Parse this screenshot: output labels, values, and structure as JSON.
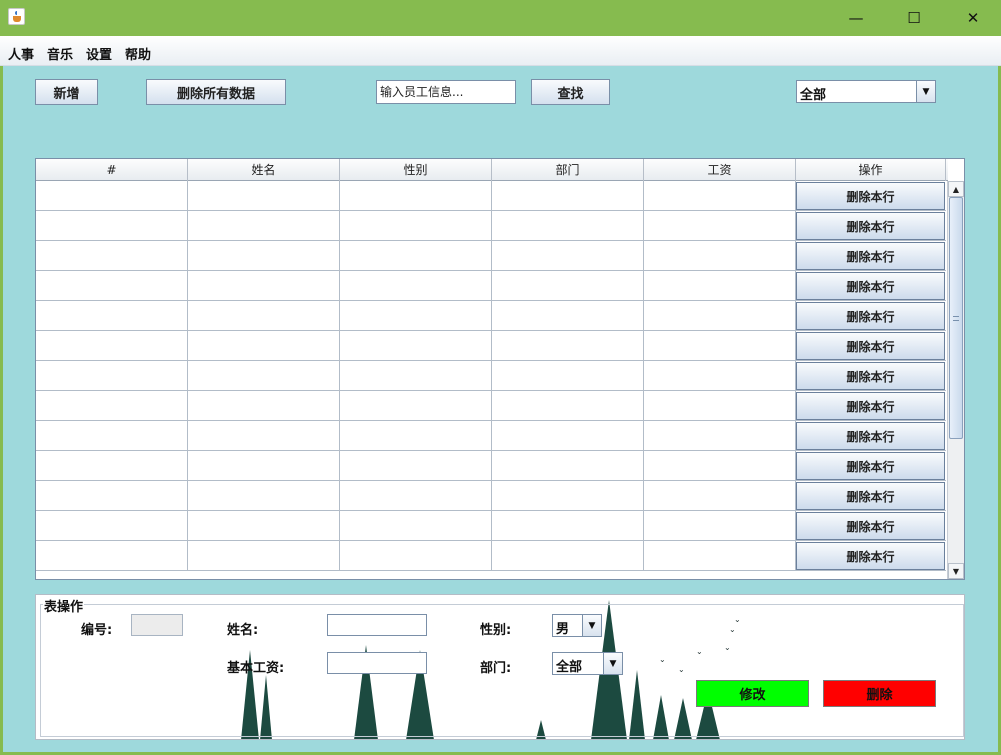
{
  "window": {
    "icon": "java-cup-icon",
    "controls": {
      "minimize": "—",
      "maximize": "☐",
      "close": "✕"
    }
  },
  "menu": [
    "人事",
    "音乐",
    "设置",
    "帮助"
  ],
  "toolbar": {
    "add_label": "新增",
    "delete_all_label": "删除所有数据",
    "search_placeholder": "输入员工信息...",
    "search_label": "查找",
    "filter_value": "全部"
  },
  "table": {
    "columns": [
      "#",
      "姓名",
      "性别",
      "部门",
      "工资",
      "操作"
    ],
    "row_action_label": "删除本行",
    "rows": 13
  },
  "form": {
    "title": "表操作",
    "id_label": "编号:",
    "name_label": "姓名:",
    "gender_label": "性别:",
    "gender_value": "男",
    "salary_label": "基本工资:",
    "dept_label": "部门:",
    "dept_value": "全部",
    "modify_label": "修改",
    "delete_label": "删除"
  },
  "colors": {
    "titlebar": "#86bb4f",
    "content_bg": "#9ed9dc",
    "modify_bg": "#00ff00",
    "delete_bg": "#ff0000"
  }
}
